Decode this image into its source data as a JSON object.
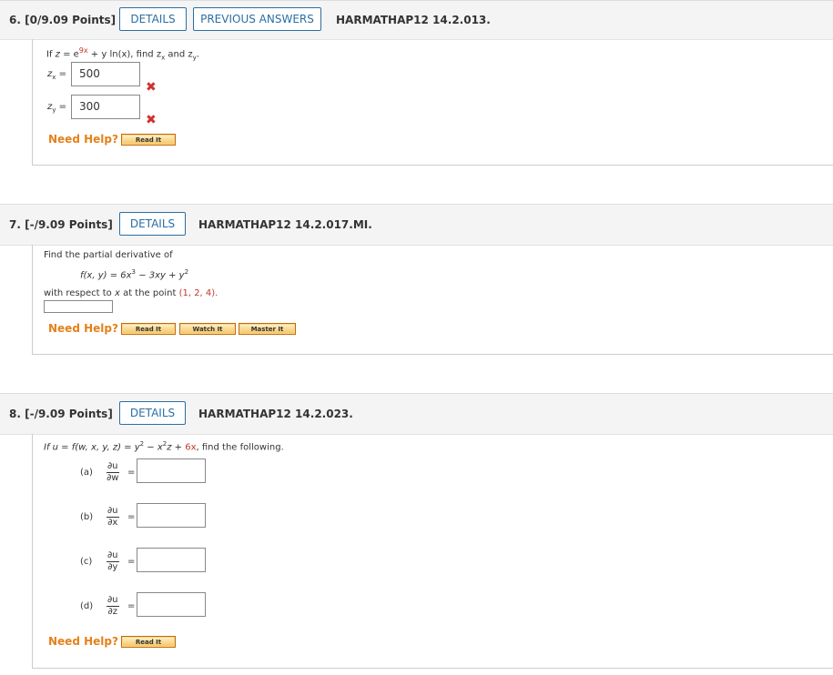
{
  "q6": {
    "number": "6.",
    "points": "[0/9.09 Points]",
    "details_label": "DETAILS",
    "previous_label": "PREVIOUS ANSWERS",
    "code": "HARMATHAP12 14.2.013.",
    "prompt_a": "If ",
    "prompt_z": "z",
    "prompt_eq": " = e",
    "prompt_exp": "9x",
    "prompt_b": " + y ln(x), find z",
    "prompt_sub_x": "x",
    "prompt_c": " and z",
    "prompt_sub_y": "y",
    "prompt_d": ".",
    "zx_label": "z",
    "zx_sub": "x",
    "zx_eq": "=",
    "zx_value": "500",
    "zy_label": "z",
    "zy_sub": "y",
    "zy_eq": "=",
    "zy_value": "300",
    "wrong_mark": "✖",
    "help_label": "Need Help?",
    "read_label": "Read It"
  },
  "q7": {
    "number": "7.",
    "points": "[-/9.09 Points]",
    "details_label": "DETAILS",
    "code": "HARMATHAP12 14.2.017.MI.",
    "line1": "Find the partial derivative of",
    "fn": "f(x, y) = 6x",
    "fn_exp1": "3",
    "fn_mid": " − 3xy + y",
    "fn_exp2": "2",
    "line3_a": "with respect to ",
    "line3_x": "x",
    "line3_b": " at the point ",
    "point": "(1, 2, 4).",
    "answer_value": "",
    "help_label": "Need Help?",
    "read_label": "Read It",
    "watch_label": "Watch It",
    "master_label": "Master It"
  },
  "q8": {
    "number": "8.",
    "points": "[-/9.09 Points]",
    "details_label": "DETAILS",
    "code": "HARMATHAP12 14.2.023.",
    "prompt_a": "If u = f(w, x, y, z) = y",
    "prompt_exp1": "2",
    "prompt_b": " − x",
    "prompt_exp2": "2",
    "prompt_c": "z + ",
    "prompt_red": "6x",
    "prompt_d": ", find the following.",
    "parts": [
      {
        "label": "(a)",
        "num": "∂u",
        "den": "∂w",
        "eq": "=",
        "value": ""
      },
      {
        "label": "(b)",
        "num": "∂u",
        "den": "∂x",
        "eq": "=",
        "value": ""
      },
      {
        "label": "(c)",
        "num": "∂u",
        "den": "∂y",
        "eq": "=",
        "value": ""
      },
      {
        "label": "(d)",
        "num": "∂u",
        "den": "∂z",
        "eq": "=",
        "value": ""
      }
    ],
    "help_label": "Need Help?",
    "read_label": "Read It"
  },
  "colors": {
    "link_blue": "#2b6ea3",
    "help_orange": "#e4811b",
    "error_red": "#d0312d"
  }
}
